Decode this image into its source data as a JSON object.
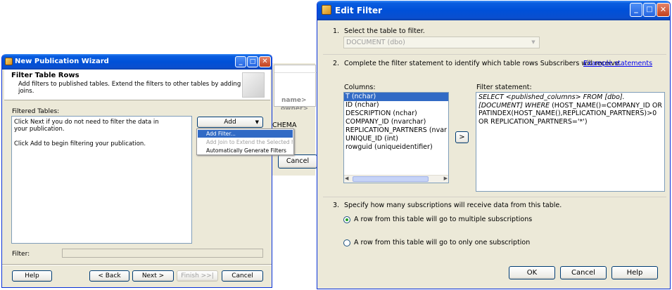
{
  "background_dialog": {
    "header_cells": [
      "name>",
      "owner>"
    ],
    "partial_text": "CHEMA comm",
    "cancel_label": "Cancel"
  },
  "wizard": {
    "title": "New Publication Wizard",
    "header_title": "Filter Table Rows",
    "header_subtitle": "Add filters to published tables. Extend the filters to other tables by adding joins.",
    "filtered_tables_label": "Filtered Tables:",
    "info_line1": "Click Next if you do not need to filter the data in your publication.",
    "info_line2": "Click Add to begin filtering your publication.",
    "add_button": "Add",
    "add_menu": [
      "Add Filter...",
      "Add Join to Extend the Selected Filter...",
      "Automatically Generate Filters"
    ],
    "filter_label": "Filter:",
    "buttons": {
      "help": "Help",
      "back": "< Back",
      "next": "Next >",
      "finish": "Finish >>|",
      "cancel": "Cancel"
    }
  },
  "edit_filter": {
    "title": "Edit Filter",
    "step1_num": "1.",
    "step1": "Select the table to filter.",
    "table_select": "DOCUMENT (dbo)",
    "step2_num": "2.",
    "step2": "Complete the filter statement to identify which table rows Subscribers will receive.",
    "example_link": "Example statements",
    "columns_label": "Columns:",
    "columns": [
      "T (nchar)",
      "ID (nchar)",
      "DESCRIPTION (nchar)",
      "COMPANY_ID (nvarchar)",
      "REPLICATION_PARTNERS (nvar",
      "UNIQUE_ID (int)",
      "rowguid (uniqueidentifier)"
    ],
    "insert_button": ">",
    "filter_statement_label": "Filter statement:",
    "filter_statement_italic": "SELECT <published_columns> FROM [dbo].[DOCUMENT] WHERE",
    "filter_statement_rest": " (HOST_NAME()=COMPANY_ID OR PATINDEX(HOST_NAME(),REPLICATION_PARTNERS)>0 OR REPLICATION_PARTNERS='*')",
    "step3_num": "3.",
    "step3": "Specify how many subscriptions will receive data from this table.",
    "radio_multiple": "A row from this table will go to multiple subscriptions",
    "radio_single": "A row from this table will go to only one subscription",
    "buttons": {
      "ok": "OK",
      "cancel": "Cancel",
      "help": "Help"
    }
  },
  "colors": {
    "titlebar_blue": "#0050d8",
    "dialog_face": "#ece9d8",
    "selection": "#316ac5",
    "link": "#0000ee"
  }
}
